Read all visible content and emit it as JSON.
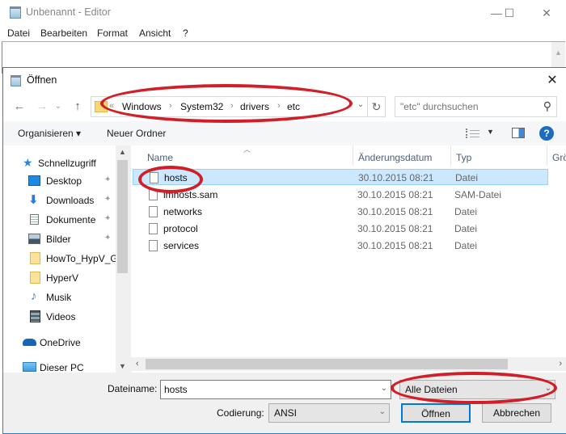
{
  "editor": {
    "title": "Unbenannt - Editor",
    "window_controls": {
      "minimize": "—",
      "maximize": "☐",
      "close": "✕"
    },
    "menu": [
      "Datei",
      "Bearbeiten",
      "Format",
      "Ansicht",
      "?"
    ]
  },
  "dialog": {
    "title": "Öffnen",
    "close": "✕",
    "nav": {
      "back": "←",
      "forward": "→",
      "recent": "⌄",
      "up": "↑",
      "refresh": "↻"
    },
    "address": {
      "overflow": "«",
      "crumbs": [
        "Windows",
        "System32",
        "drivers",
        "etc"
      ],
      "separator": "›"
    },
    "search": {
      "placeholder": "\"etc\" durchsuchen",
      "icon": "⚲"
    },
    "toolbar": {
      "organize": "Organisieren ▾",
      "new_folder": "Neuer Ordner",
      "help": "?"
    },
    "nav_pane": {
      "items": [
        {
          "label": "Schnellzugriff",
          "icon": "star-icon"
        },
        {
          "label": "Desktop",
          "icon": "desktop-icon",
          "pinned": true
        },
        {
          "label": "Downloads",
          "icon": "downloads-icon",
          "pinned": true
        },
        {
          "label": "Dokumente",
          "icon": "documents-icon",
          "pinned": true
        },
        {
          "label": "Bilder",
          "icon": "pictures-icon",
          "pinned": true
        },
        {
          "label": "HowTo_HypV_G",
          "icon": "folder-icon"
        },
        {
          "label": "HyperV",
          "icon": "folder-icon"
        },
        {
          "label": "Musik",
          "icon": "music-icon"
        },
        {
          "label": "Videos",
          "icon": "videos-icon"
        },
        {
          "label": "OneDrive",
          "icon": "onedrive-icon"
        },
        {
          "label": "Dieser PC",
          "icon": "pc-icon"
        }
      ],
      "pin_glyph": "📌"
    },
    "file_list": {
      "columns": [
        "Name",
        "Änderungsdatum",
        "Typ",
        "Grö"
      ],
      "rows": [
        {
          "name": "hosts",
          "date": "30.10.2015 08:21",
          "type": "Datei",
          "selected": true
        },
        {
          "name": "lmhosts.sam",
          "date": "30.10.2015 08:21",
          "type": "SAM-Datei"
        },
        {
          "name": "networks",
          "date": "30.10.2015 08:21",
          "type": "Datei"
        },
        {
          "name": "protocol",
          "date": "30.10.2015 08:21",
          "type": "Datei"
        },
        {
          "name": "services",
          "date": "30.10.2015 08:21",
          "type": "Datei"
        }
      ]
    },
    "bottom": {
      "filename_label": "Dateiname:",
      "filename_value": "hosts",
      "filetype_value": "Alle Dateien",
      "encoding_label": "Codierung:",
      "encoding_value": "ANSI",
      "open_button": "Öffnen",
      "cancel_button": "Abbrechen"
    }
  },
  "annotation_color": "#d11e27"
}
